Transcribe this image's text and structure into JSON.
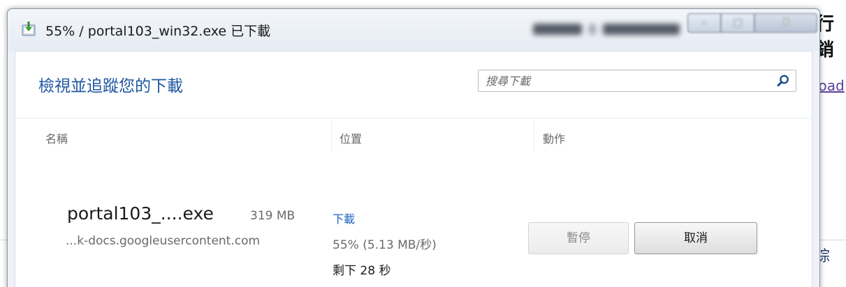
{
  "background": {
    "top_text": "行銷",
    "link_text": "load",
    "bottom_text": "綜"
  },
  "window": {
    "title": "55% / portal103_win32.exe 已下載",
    "controls": {
      "minimize": "–",
      "maximize": "□",
      "close": "X"
    }
  },
  "header": {
    "title": "檢視並追蹤您的下載",
    "search_placeholder": "搜尋下載"
  },
  "columns": {
    "name": "名稱",
    "location": "位置",
    "actions": "動作"
  },
  "download": {
    "file_name": "portal103_....exe",
    "file_size": "319 MB",
    "source": "...k-docs.googleusercontent.com",
    "location_link": "下載",
    "progress": "55% (5.13 MB/秒)",
    "progress_percent": 55,
    "remaining": "剩下  28 秒",
    "pause_label": "暫停",
    "cancel_label": "取消"
  },
  "colors": {
    "accent": "#1f57a0",
    "link": "#1f64c0"
  }
}
